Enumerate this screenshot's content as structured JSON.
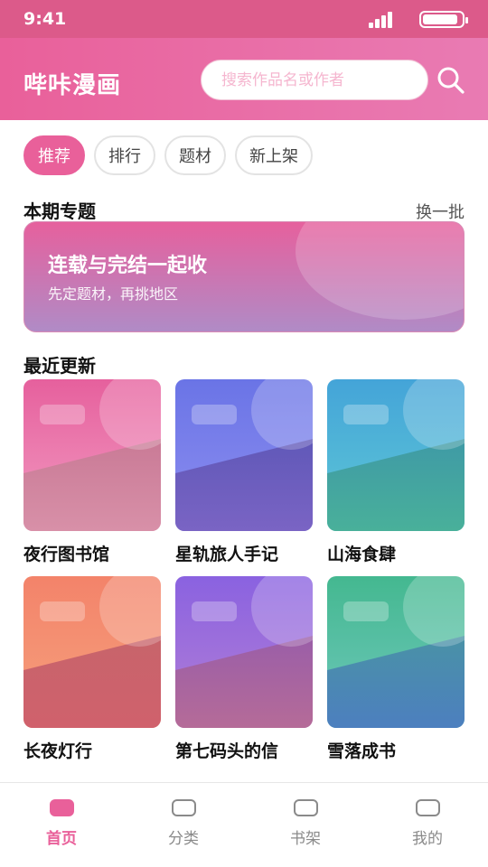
{
  "status_bar": {
    "time": "9:41"
  },
  "header": {
    "title": "哔咔漫画"
  },
  "search": {
    "placeholder": "搜索作品名或作者"
  },
  "chips": [
    {
      "label": "推荐",
      "active": true
    },
    {
      "label": "排行",
      "active": false
    },
    {
      "label": "题材",
      "active": false
    },
    {
      "label": "新上架",
      "active": false
    }
  ],
  "featured": {
    "section_title": "本期专题",
    "swap_label": "换一批",
    "banner_title": "连载与完结一起收",
    "banner_subtitle": "先定题材，再挑地区"
  },
  "recent": {
    "section_title": "最近更新",
    "items": [
      {
        "title": "夜行图书馆",
        "colors": [
          "#e6609d",
          "#f29bc2",
          "#c97a96",
          "#d890a8"
        ]
      },
      {
        "title": "星轨旅人手记",
        "colors": [
          "#6a74e6",
          "#8d8ef0",
          "#6058b8",
          "#7a64c4"
        ]
      },
      {
        "title": "山海食肆",
        "colors": [
          "#44a4d8",
          "#5ec8d6",
          "#3f9aa6",
          "#49b09a"
        ]
      },
      {
        "title": "长夜灯行",
        "colors": [
          "#f3836a",
          "#f6a17d",
          "#c7646b",
          "#d0616c"
        ]
      },
      {
        "title": "第七码头的信",
        "colors": [
          "#8a62e0",
          "#b37fd6",
          "#9a5ea8",
          "#b56b98"
        ]
      },
      {
        "title": "雪落成书",
        "colors": [
          "#44b890",
          "#6fc8bc",
          "#4a92a6",
          "#4c7fbf"
        ]
      }
    ]
  },
  "tabbar": [
    {
      "label": "首页",
      "active": true
    },
    {
      "label": "分类",
      "active": false
    },
    {
      "label": "书架",
      "active": false
    },
    {
      "label": "我的",
      "active": false
    }
  ],
  "theme": {
    "accent": "#e9609a",
    "status_bar": "#dc5a8a"
  }
}
